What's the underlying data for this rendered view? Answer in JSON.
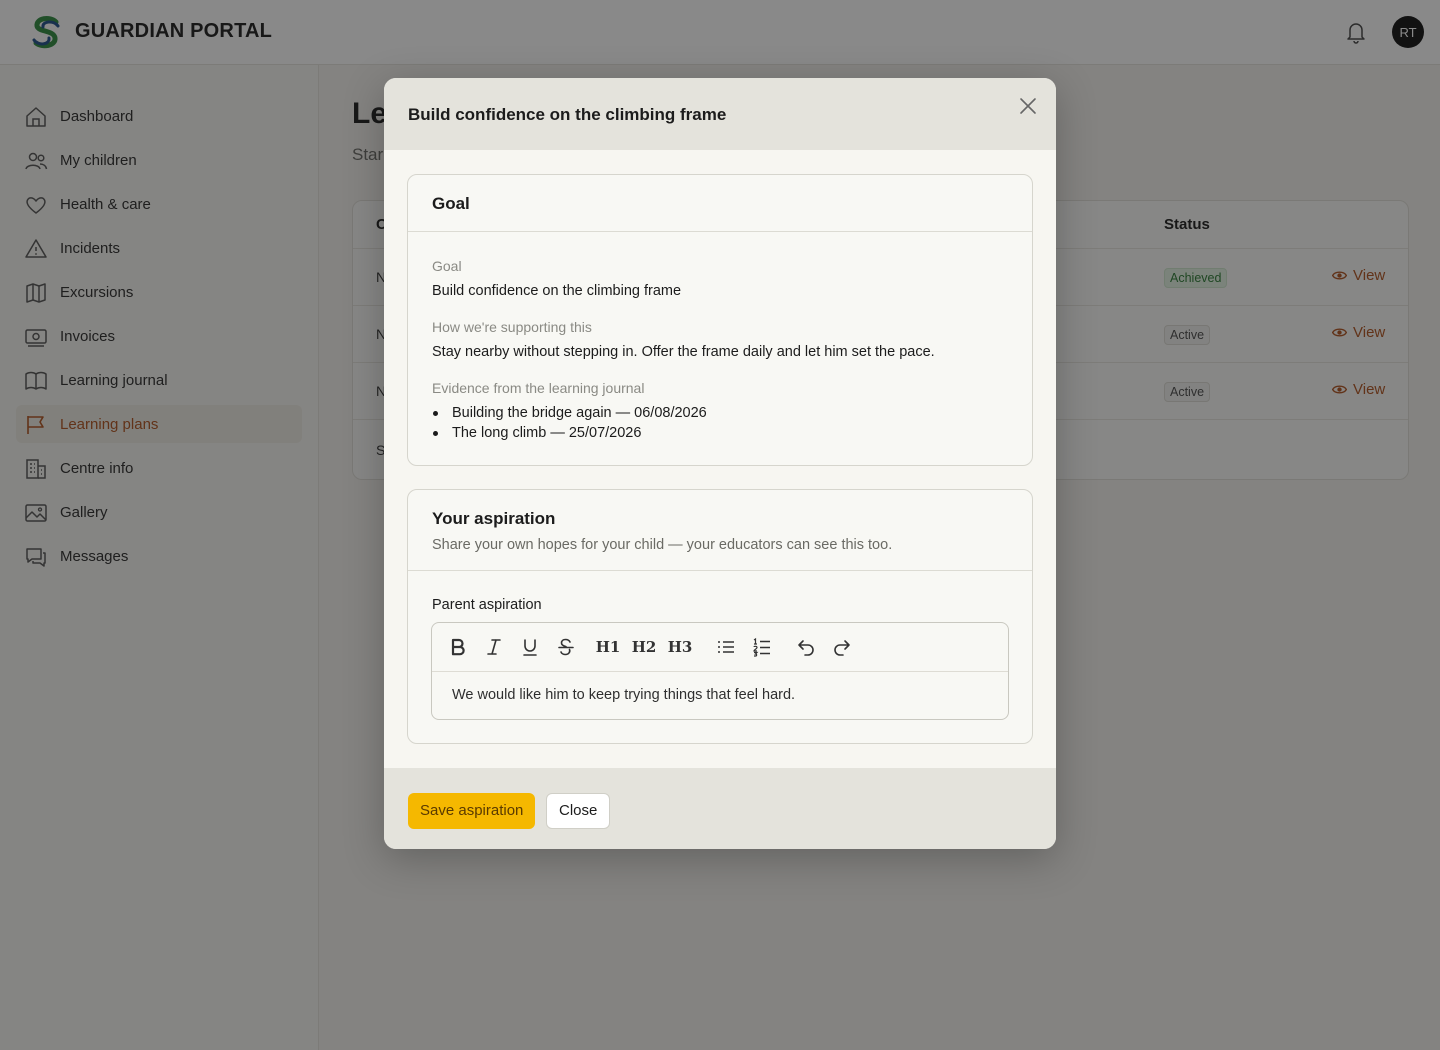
{
  "app": {
    "brand": "GUARDIAN PORTAL",
    "user_initials": "RT"
  },
  "sidebar": {
    "items": [
      {
        "label": "Dashboard",
        "icon": "home-icon"
      },
      {
        "label": "My children",
        "icon": "users-icon"
      },
      {
        "label": "Health & care",
        "icon": "heart-icon"
      },
      {
        "label": "Incidents",
        "icon": "warning-icon"
      },
      {
        "label": "Excursions",
        "icon": "map-icon"
      },
      {
        "label": "Invoices",
        "icon": "money-icon"
      },
      {
        "label": "Learning journal",
        "icon": "book-icon"
      },
      {
        "label": "Learning plans",
        "icon": "flag-icon",
        "active": true
      },
      {
        "label": "Centre info",
        "icon": "building-icon"
      },
      {
        "label": "Gallery",
        "icon": "image-icon"
      },
      {
        "label": "Messages",
        "icon": "chat-icon"
      }
    ]
  },
  "main": {
    "title_visible": "Le",
    "subtitle_visible": "Star",
    "table": {
      "first_col_header_visible": "C",
      "status_header": "Status",
      "rows": [
        {
          "first_cell_visible": "N",
          "status": "Achieved",
          "action": "View"
        },
        {
          "first_cell_visible": "N",
          "status": "Active",
          "action": "View"
        },
        {
          "first_cell_visible": "N",
          "status": "Active",
          "action": "View"
        }
      ],
      "footer_visible": "S"
    }
  },
  "modal": {
    "title": "Build confidence on the climbing frame",
    "goal_card": {
      "title": "Goal",
      "goal_label": "Goal",
      "goal_value": "Build confidence on the climbing frame",
      "support_label": "How we're supporting this",
      "support_value": "Stay nearby without stepping in. Offer the frame daily and let him set the pace.",
      "evidence_label": "Evidence from the learning journal",
      "evidence": [
        "Building the bridge again — 06/08/2026",
        "The long climb — 25/07/2026"
      ]
    },
    "aspiration_card": {
      "title": "Your aspiration",
      "subtitle": "Share your own hopes for your child — your educators can see this too.",
      "editor_label": "Parent aspiration",
      "editor_content": "We would like him to keep trying things that feel hard.",
      "toolbar": {
        "h1": "H1",
        "h2": "H2",
        "h3": "H3"
      }
    },
    "buttons": {
      "save": "Save aspiration",
      "close": "Close"
    }
  },
  "colors": {
    "accent": "#b0521e",
    "primary_button": "#f5b800",
    "achieved_badge": "#2a7a33"
  }
}
